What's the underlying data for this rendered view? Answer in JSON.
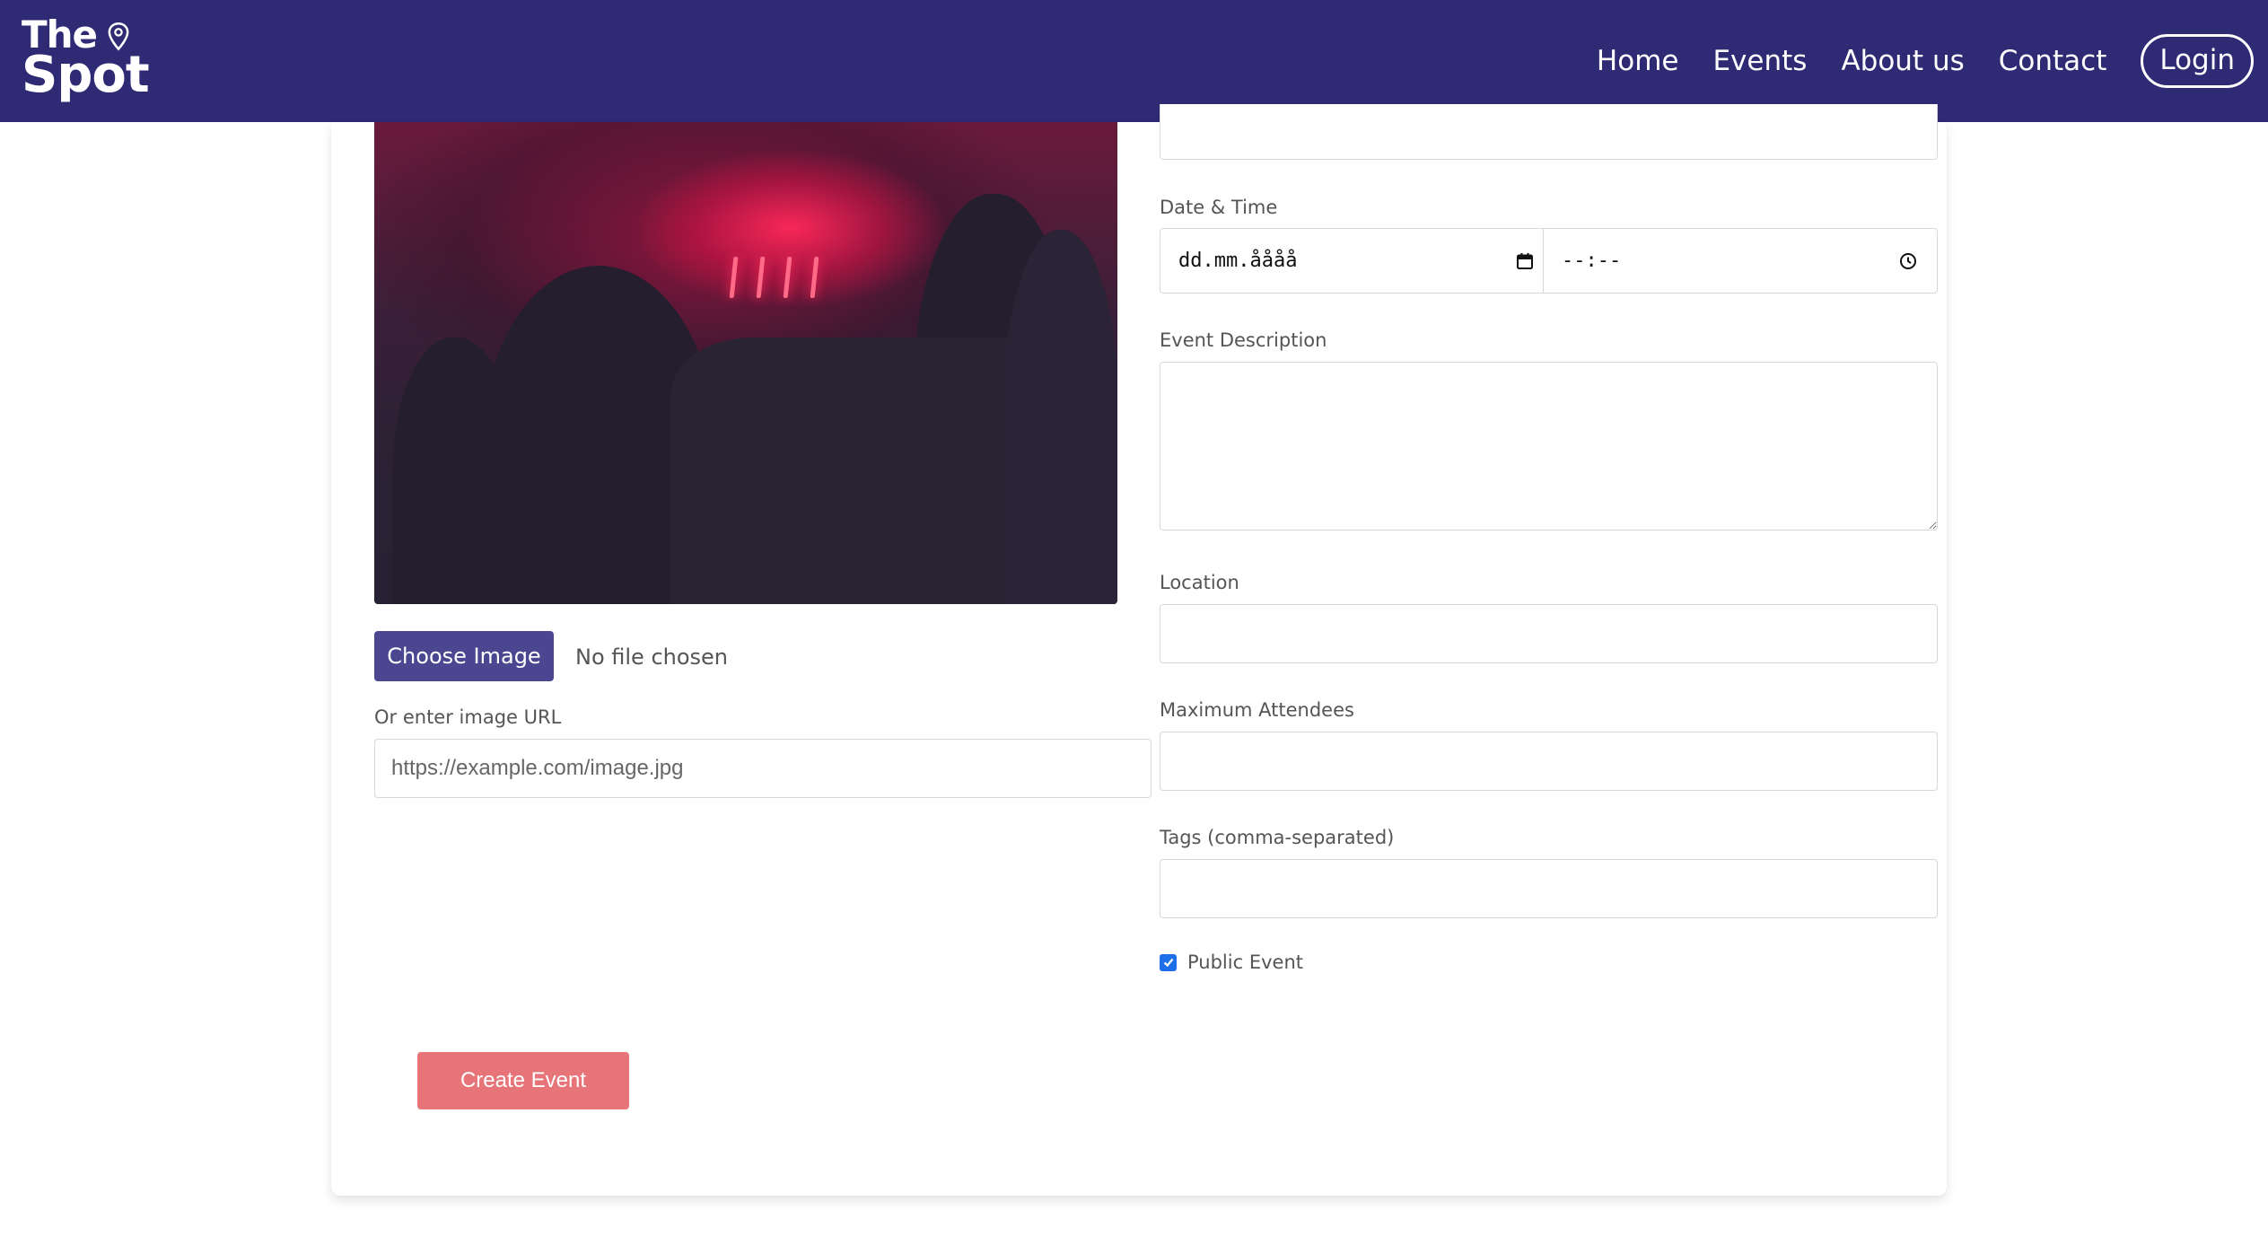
{
  "navbar": {
    "logo_line1": "The",
    "logo_line2": "Spot",
    "links": [
      "Home",
      "Events",
      "About us",
      "Contact"
    ],
    "login_label": "Login",
    "background_color": "#2e2a74"
  },
  "image_upload": {
    "choose_label": "Choose Image",
    "file_status": "No file chosen",
    "url_label": "Or enter image URL",
    "url_placeholder": "https://example.com/image.jpg"
  },
  "form": {
    "datetime_label": "Date & Time",
    "date_placeholder": "dd.mm.åååå",
    "time_placeholder": "--:--",
    "description_label": "Event Description",
    "location_label": "Location",
    "max_attendees_label": "Maximum Attendees",
    "tags_label": "Tags (comma-separated)",
    "public_label": "Public Event",
    "public_checked": true,
    "submit_label": "Create Event"
  },
  "icons": {
    "location_pin": "map-pin-icon",
    "calendar": "calendar-icon",
    "clock": "clock-icon",
    "check": "check-icon"
  },
  "colors": {
    "primary_button": "#4a4790",
    "submit_button": "#e67478",
    "checkbox": "#1e6fe8"
  }
}
